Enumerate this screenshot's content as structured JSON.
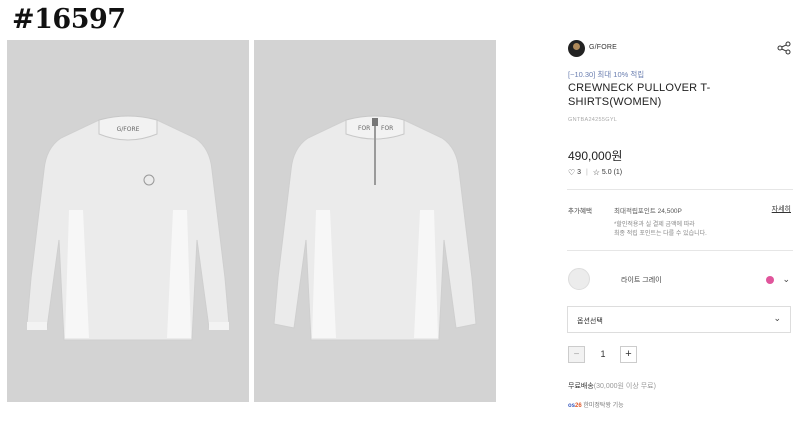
{
  "overlay": {
    "id_label": "#16597"
  },
  "gallery": {
    "images": [
      {
        "name": "front view",
        "collar_text": "G/FORE"
      },
      {
        "name": "back view",
        "collar_text": "G/FORE"
      }
    ],
    "background_color": "#d3d3d3",
    "garment_color": "#ededed"
  },
  "product": {
    "brand": "G/FORE",
    "promo": "[~10.30] 최대 10% 적립",
    "title": "CREWNECK PULLOVER T-SHIRTS(WOMEN)",
    "code": "GNTBA24255GYL",
    "price": "490,000원",
    "likes": "3",
    "rating": "5.0",
    "review_count": "(1)",
    "benefits": {
      "label": "추가혜택",
      "points": "최대적립포인트 24,500P",
      "note_line1": "*할인적용과 실 결제 금액에 따라",
      "note_line2": "최종 적립 포인트는 다를 수 있습니다.",
      "detail_link": "자세히"
    },
    "color": {
      "name": "라이트 그레이",
      "dot_color": "#e0559b"
    },
    "option_select": {
      "label": "옵션선택"
    },
    "quantity": {
      "minus": "−",
      "value": "1",
      "plus": "+"
    },
    "shipping": {
      "label": "무료배송",
      "detail": "(30,000원 이상 무료)"
    },
    "logistics": {
      "badge_prefix": "os",
      "badge_num": "26",
      "text": "한미정탁왕 기능"
    }
  },
  "icons": {
    "share": "share-icon",
    "heart": "heart-icon",
    "star": "star-icon",
    "chevron": "chevron-down-icon"
  }
}
